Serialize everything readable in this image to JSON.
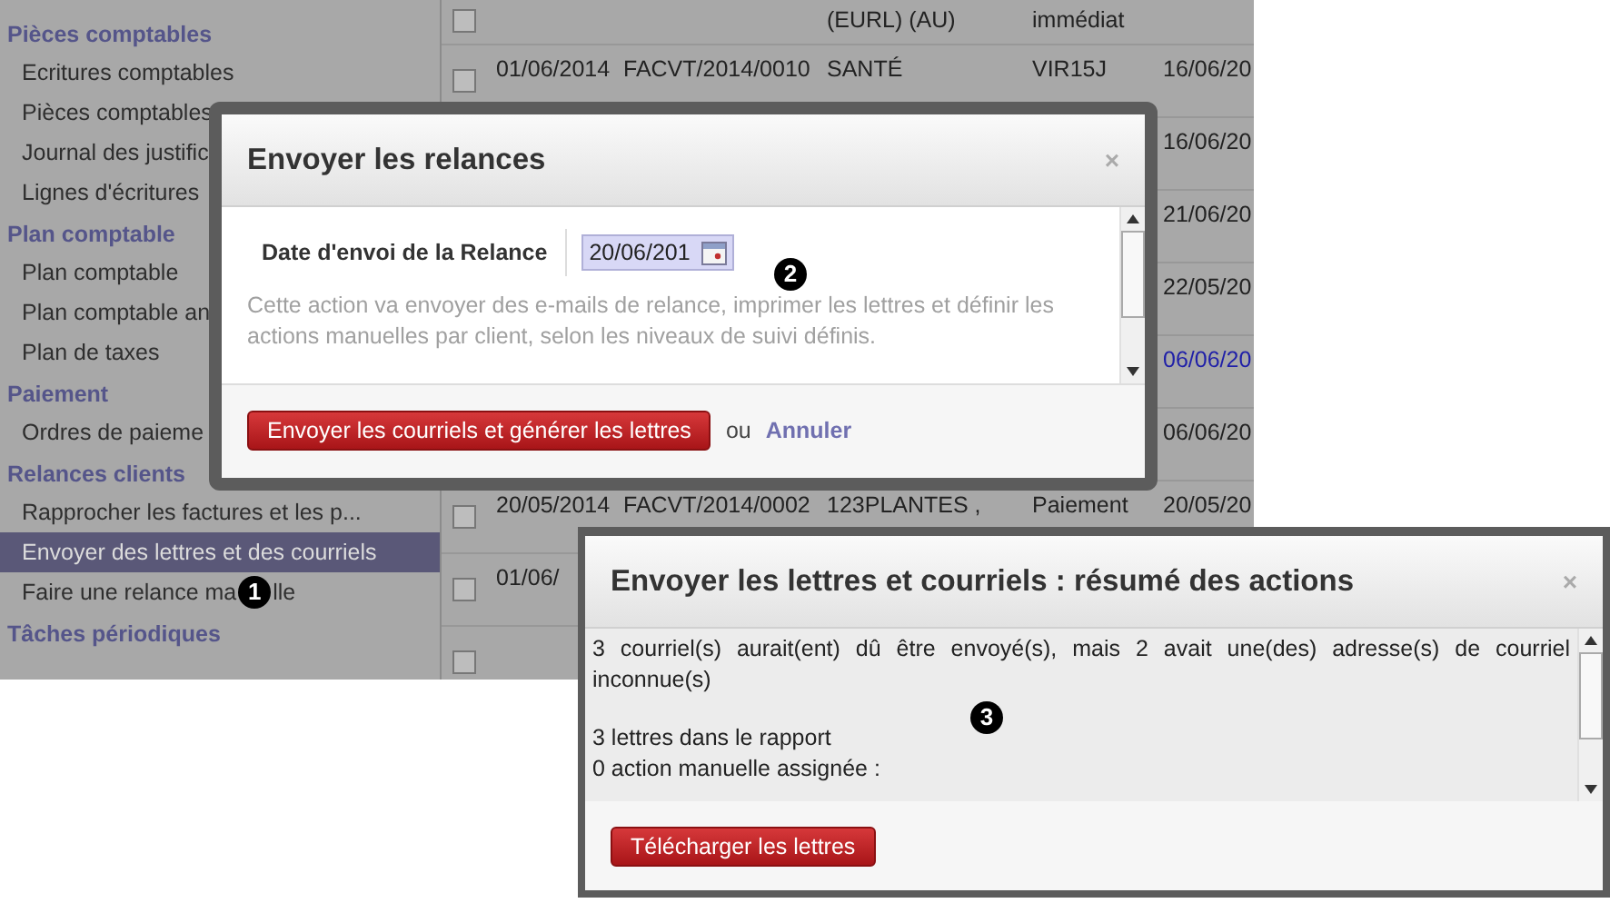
{
  "sidebar": {
    "sections": [
      {
        "title": "Pièces comptables",
        "items": [
          {
            "label": "Ecritures comptables",
            "selected": false
          },
          {
            "label": "Pièces comptables",
            "selected": false
          },
          {
            "label": "Journal des justific",
            "selected": false
          },
          {
            "label": "Lignes d'écritures",
            "selected": false
          }
        ]
      },
      {
        "title": "Plan comptable",
        "items": [
          {
            "label": "Plan comptable",
            "selected": false
          },
          {
            "label": "Plan comptable an",
            "selected": false
          },
          {
            "label": "Plan de taxes",
            "selected": false
          }
        ]
      },
      {
        "title": "Paiement",
        "items": [
          {
            "label": "Ordres de paieme",
            "selected": false
          }
        ]
      },
      {
        "title": "Relances clients",
        "items": [
          {
            "label": "Rapprocher les factures et les p...",
            "selected": false
          },
          {
            "label": "Envoyer des lettres et des courriels",
            "selected": true
          },
          {
            "label": "Faire une relance ma",
            "callout": "1",
            "label_rest": "lle",
            "selected": false
          }
        ]
      },
      {
        "title": "Tâches périodiques"
      }
    ]
  },
  "table": {
    "rows": [
      {
        "checked": false,
        "partner": [
          "(EURL) (AU)"
        ],
        "payment": [
          "immédiat"
        ]
      },
      {
        "checked": false,
        "date": "01/06/2014",
        "ref": "FACVT/2014/0010",
        "partner": [
          "SANTÉ"
        ],
        "payment": [
          "VIR15J"
        ],
        "due": "16/06/20",
        "color": "#222222"
      },
      {
        "due": "16/06/20",
        "color": "#222222"
      },
      {
        "due": "21/06/20",
        "color": "#222222"
      },
      {
        "due": "22/05/20",
        "color": "#222222"
      },
      {
        "due": "06/06/20",
        "color": "#1f1fa8"
      },
      {
        "due": "06/06/20",
        "color": "#222222"
      },
      {
        "checked": false,
        "date": "20/05/2014",
        "ref": "FACVT/2014/0002",
        "partner": [
          "123PLANTES ,"
        ],
        "payment": [
          "Paiement"
        ],
        "due": "20/05/20",
        "color": "#222222"
      },
      {
        "checked": false,
        "date": "01/06/"
      },
      {
        "checked": false
      }
    ]
  },
  "dialog_relances": {
    "title": "Envoyer les relances",
    "close": "×",
    "field_label": "Date d'envoi de la Relance",
    "date_value": "20/06/201",
    "help": "Cette action va envoyer des e-mails de relance, imprimer les lettres et définir les actions manuelles par client, selon les niveaux de suivi définis.",
    "primary_button": "Envoyer les courriels et générer les lettres",
    "or": "ou",
    "cancel": "Annuler",
    "callout": "2"
  },
  "dialog_summary": {
    "title": "Envoyer les lettres et courriels : résumé des actions",
    "close": "×",
    "messages": [
      "3 courriel(s) aurait(ent) dû être envoyé(s), mais 2 avait une(des) adresse(s) de courriel inconnue(s)",
      "3 lettres dans le rapport",
      "0 action manuelle assignée :"
    ],
    "button": "Télécharger les lettres",
    "callout": "3"
  }
}
